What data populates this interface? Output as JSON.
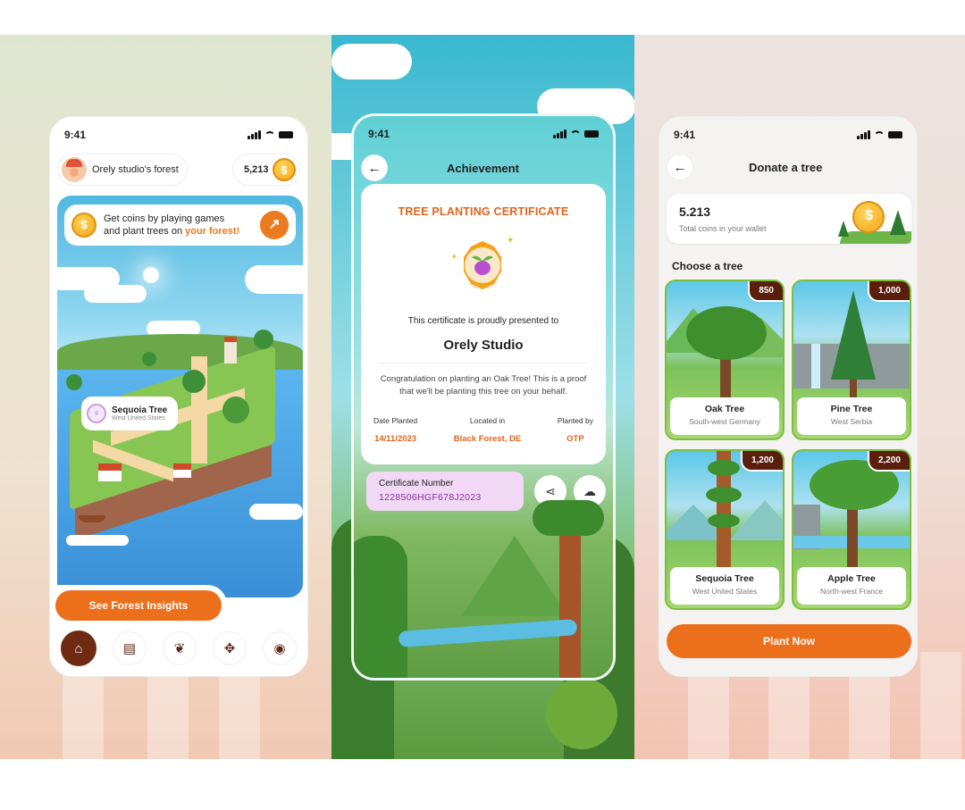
{
  "screens": {
    "home": {
      "status_time": "9:41",
      "forest_name": "Orely studio's forest",
      "coin_balance": "5,213",
      "coin_symbol": "$",
      "tip_line1": "Get coins by playing games",
      "tip_line2": "and plant trees on ",
      "tip_highlight": "your forest!",
      "pin": {
        "title": "Sequoia Tree",
        "location": "West United States"
      },
      "insights_button": "See Forest Insights",
      "nav_items": [
        {
          "icon": "home-icon",
          "glyph": "⌂"
        },
        {
          "icon": "clipboard-icon",
          "glyph": "▤"
        },
        {
          "icon": "plant-hand-icon",
          "glyph": "❦"
        },
        {
          "icon": "gamepad-icon",
          "glyph": "✥"
        },
        {
          "icon": "profile-icon",
          "glyph": "◉"
        }
      ]
    },
    "achievement": {
      "status_time": "9:41",
      "title": "Achievement",
      "certificate_title": "TREE PLANTING CERTIFICATE",
      "presented_to": "This certificate is proudly presented to",
      "recipient": "Orely Studio",
      "message": "Congratulation on planting an Oak Tree! This is a proof that we'll be planting this tree on your behalf.",
      "meta": [
        {
          "label": "Date Planted",
          "value": "14/11/2023"
        },
        {
          "label": "Located in",
          "value": "Black Forest, DE"
        },
        {
          "label": "Planted by",
          "value": "OTP"
        }
      ],
      "certificate_number_label": "Certificate Number",
      "certificate_number": "1228506HGF678J2023"
    },
    "donate": {
      "status_time": "9:41",
      "title": "Donate a tree",
      "wallet_amount": "5.213",
      "wallet_label": "Total coins in your wallet",
      "choose_label": "Choose a tree",
      "trees": [
        {
          "name": "Oak Tree",
          "location": "South-west Germany",
          "price": "850"
        },
        {
          "name": "Pine Tree",
          "location": "West Serbia",
          "price": "1,000"
        },
        {
          "name": "Sequoia Tree",
          "location": "West United States",
          "price": "1,200"
        },
        {
          "name": "Apple Tree",
          "location": "North-west France",
          "price": "2,200"
        }
      ],
      "plant_button": "Plant Now"
    }
  },
  "colors": {
    "accent": "#ec6f1c",
    "brown": "#5a1e0c",
    "green": "#7cbf3c"
  }
}
